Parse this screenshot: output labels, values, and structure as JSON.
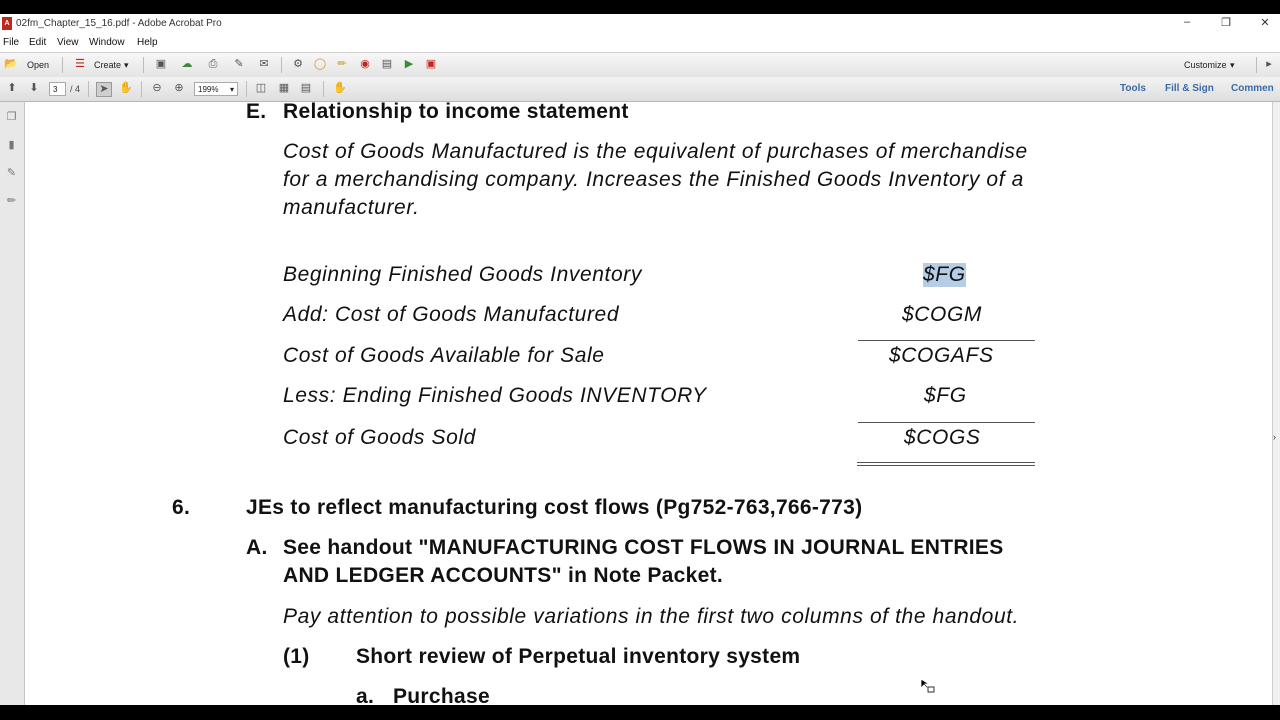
{
  "window": {
    "title": "02fm_Chapter_15_16.pdf - Adobe Acrobat Pro",
    "minimize_icon": "minimize-icon",
    "restore_icon": "restore-icon",
    "close_icon": "close-icon"
  },
  "menu": [
    "File",
    "Edit",
    "View",
    "Window",
    "Help"
  ],
  "toolbar": {
    "open_label": "Open",
    "create_label": "Create",
    "customize_label": "Customize",
    "page_current": "3",
    "page_total": "/ 4",
    "zoom": "199%",
    "tools_label": "Tools",
    "fill_sign_label": "Fill & Sign",
    "comment_label": "Commen"
  },
  "document": {
    "section_e": {
      "letter": "E.",
      "title": "Relationship to income statement"
    },
    "intro_lines": [
      "Cost of Goods Manufactured is the equivalent of purchases of merchandise",
      "for a merchandising company.  Increases the Finished Goods Inventory of a",
      "manufacturer."
    ],
    "rows": [
      {
        "label": "Beginning Finished Goods Inventory",
        "value": "$FG"
      },
      {
        "label": "Add: Cost of Goods Manufactured",
        "value": "$COGM"
      },
      {
        "label": "Cost of Goods Available for Sale",
        "value": "$COGAFS"
      },
      {
        "label": "Less: Ending Finished Goods INVENTORY",
        "value": "$FG"
      },
      {
        "label": "Cost of Goods Sold",
        "value": "$COGS"
      }
    ],
    "section_6": {
      "number": "6.",
      "title": "JEs to reflect manufacturing cost flows (Pg752-763,766-773)"
    },
    "section_a": {
      "letter": "A.",
      "lines": [
        "See handout \"MANUFACTURING COST FLOWS IN JOURNAL ENTRIES",
        "AND LEDGER ACCOUNTS\" in Note Packet."
      ],
      "note": "Pay attention to possible variations in the first two columns of the handout."
    },
    "item_1": {
      "number": "(1)",
      "title": "Short review of Perpetual inventory system"
    },
    "item_a": {
      "letter": "a.",
      "title": "Purchase"
    }
  }
}
